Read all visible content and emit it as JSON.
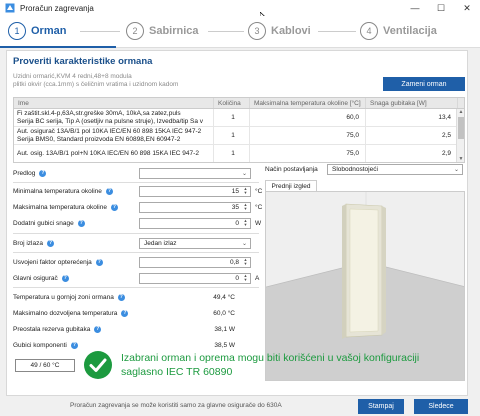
{
  "window": {
    "title": "Proračun zagrevanja",
    "minimize": "—",
    "maximize": "☐",
    "close": "✕"
  },
  "steps": [
    {
      "num": "1",
      "label": "Orman"
    },
    {
      "num": "2",
      "label": "Sabirnica"
    },
    {
      "num": "3",
      "label": "Kablovi"
    },
    {
      "num": "4",
      "label": "Ventilacija"
    }
  ],
  "section": {
    "heading": "Proveriti karakteristike ormana",
    "subtitle_line1": "Uzidni ormarić,KVM 4 redni,48+8 modula",
    "subtitle_line2": "plitki okvir (cca.1mm) s čeličnim vratima i uzidnom kadom",
    "replace_button": "Zameni orman"
  },
  "table": {
    "headers": [
      "Ime",
      "Količina",
      "Maksimalna temperatura okoline [°C]",
      "Snaga gubitaka [W]"
    ],
    "rows": [
      {
        "name_l1": "Fi zaštit.skl.4-p,63A,str.greške 30mA, 10kA,sa zatez,puls",
        "name_l2": "Serija BC serija, Tip A (osetljiv na pulsne struje), Izvedba/tip Sa v",
        "qty": "1",
        "temp": "60,0",
        "loss": "13,4"
      },
      {
        "name_l1": "Aut. osigurač 13A/B/1 pol 10KA IEC/EN 60 898 15KA IEC 947-2",
        "name_l2": "Serija BMS0, Standard proizvoda EN 60898,EN 60947-2",
        "qty": "1",
        "temp": "75,0",
        "loss": "2,5"
      },
      {
        "name_l1": "Aut. osig. 13A/B/1 pol+N  10KA IEC/EN 60 898 15KA IEC 947-2",
        "name_l2": "",
        "qty": "1",
        "temp": "75,0",
        "loss": "2,9"
      }
    ]
  },
  "form": {
    "predlog_label": "Predlog",
    "min_temp_label": "Minimalna temperatura okoline",
    "min_temp_value": "15",
    "min_temp_unit": "°C",
    "max_temp_label": "Maksimalna temperatura okoline",
    "max_temp_value": "35",
    "max_temp_unit": "°C",
    "extra_loss_label": "Dodatni gubici snage",
    "extra_loss_value": "0",
    "extra_loss_unit": "W",
    "outputs_label": "Broj izlaza",
    "outputs_value": "Jedan izlaz",
    "load_factor_label": "Usvojeni faktor opterećenja",
    "load_factor_value": "0,8",
    "main_fuse_label": "Glavni osigurač",
    "main_fuse_value": "0",
    "main_fuse_unit": "A",
    "upper_temp_label": "Temperatura u gornjoj zoni ormana",
    "upper_temp_value": "49,4 °C",
    "max_allowed_label": "Maksimalno dozvoljena temperatura",
    "max_allowed_value": "60,0 °C",
    "reserve_label": "Preostala rezerva gubitaka",
    "reserve_value": "38,1 W",
    "component_loss_label": "Gubici komponenti",
    "component_loss_value": "38,5 W"
  },
  "mounting": {
    "label": "Način postavljanja",
    "value": "Slobodnostojeći",
    "tab": "Prednji izgled"
  },
  "result": {
    "temp_box": "49 / 60 °C",
    "message_line1": "Izabrani orman i oprema mogu biti korišćeni u vašoj konfiguraciji",
    "message_line2": "saglasno IEC TR 60890"
  },
  "footer": {
    "info": "Proračun zagrevanja se može koristiti samo za glavne osigurače do 630A",
    "print": "Stampaj",
    "next": "Sledece"
  },
  "colors": {
    "accent": "#1f5fa8",
    "success": "#1c9a3f"
  }
}
